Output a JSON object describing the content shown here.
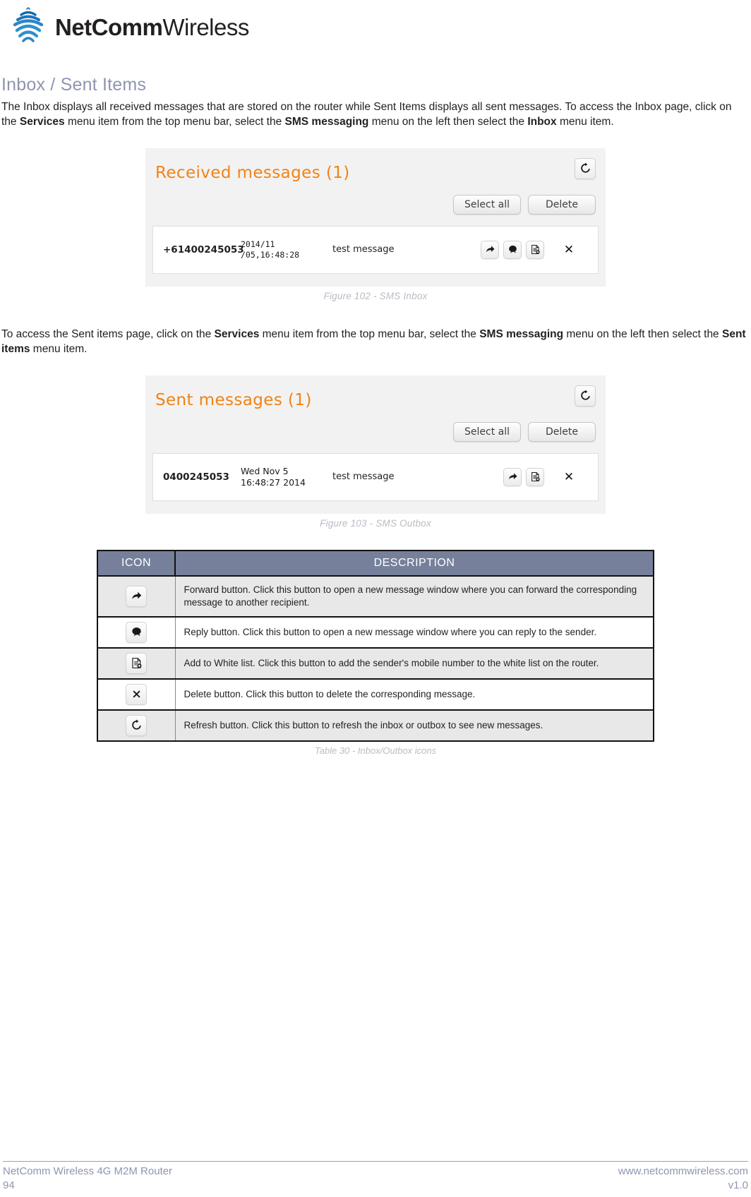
{
  "brand": {
    "name_bold": "NetComm",
    "name_light": "Wireless",
    "logo_color": "#1b75bb"
  },
  "section": {
    "title": "Inbox / Sent Items",
    "paragraph1_part1": "The Inbox displays all received messages that are stored on the router while Sent Items displays all sent messages. To access the Inbox page, click on the ",
    "paragraph1_bold1": "Services",
    "paragraph1_part2": " menu item from the top menu bar, select the ",
    "paragraph1_bold2": "SMS messaging",
    "paragraph1_part3": " menu on the left then select the ",
    "paragraph1_bold3": "Inbox",
    "paragraph1_part4": " menu item.",
    "paragraph2_part1": "To access the Sent items page, click on the ",
    "paragraph2_bold1": "Services",
    "paragraph2_part2": " menu item from the top menu bar, select the ",
    "paragraph2_bold2": "SMS messaging",
    "paragraph2_part3": " menu on the left then select the ",
    "paragraph2_bold3": "Sent items",
    "paragraph2_part4": " menu item."
  },
  "inbox_panel": {
    "title": "Received messages (1)",
    "title_color": "#f08316",
    "refresh_icon": "refresh-icon",
    "select_all_label": "Select all",
    "delete_label": "Delete",
    "message": {
      "number": "+61400245053",
      "date": "2014/11\n/05,16:48:28",
      "text": "test message",
      "actions": [
        "forward-icon",
        "reply-icon",
        "add-to-whitelist-icon"
      ],
      "delete_glyph": "✕"
    }
  },
  "outbox_panel": {
    "title": "Sent messages (1)",
    "title_color": "#f08316",
    "refresh_icon": "refresh-icon",
    "select_all_label": "Select all",
    "delete_label": "Delete",
    "message": {
      "number": "0400245053",
      "date": "Wed Nov 5 16:48:27 2014",
      "text": "test message",
      "actions": [
        "forward-icon",
        "add-to-whitelist-icon"
      ],
      "delete_glyph": "✕"
    }
  },
  "figures": {
    "figure_102": "Figure 102 - SMS Inbox",
    "figure_103": "Figure 103 - SMS Outbox",
    "table_30": "Table 30 - Inbox/Outbox icons"
  },
  "icon_table": {
    "header_icon": "ICON",
    "header_description": "DESCRIPTION",
    "header_bg": "#76809b",
    "rows": [
      {
        "icon": "forward-icon",
        "description": "Forward button. Click this button to open a new message window where you can forward the corresponding message to another recipient."
      },
      {
        "icon": "reply-icon",
        "description": "Reply button. Click this button to open a new message window where you can reply to the sender."
      },
      {
        "icon": "add-to-whitelist-icon",
        "description": "Add to White list. Click this button to add the sender's mobile number to the white list on the router."
      },
      {
        "icon": "delete-icon",
        "description": "Delete button. Click this button to delete the corresponding message."
      },
      {
        "icon": "refresh-icon",
        "description": "Refresh button. Click this button to refresh the inbox or outbox to see new messages."
      }
    ]
  },
  "footer": {
    "product": "NetComm Wireless 4G M2M Router",
    "page_number": "94",
    "website": "www.netcommwireless.com",
    "version": "v1.0",
    "color": "#8e95b0"
  }
}
